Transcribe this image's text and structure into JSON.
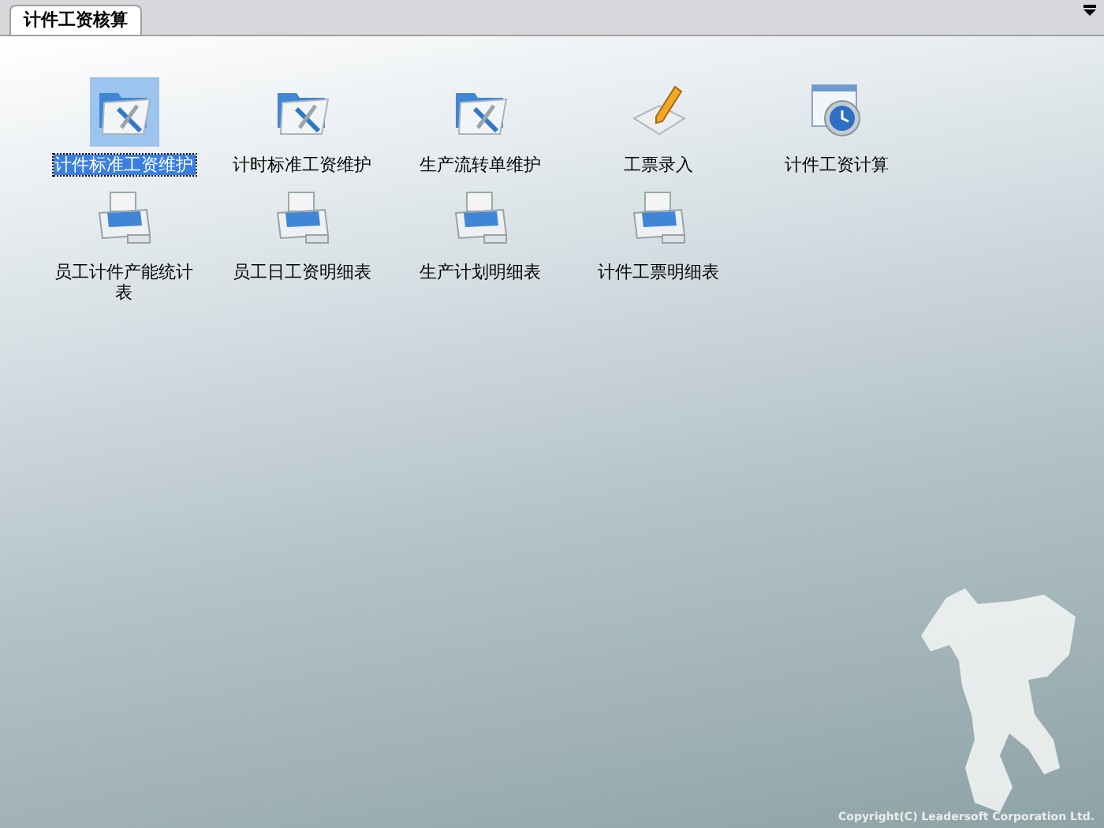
{
  "tabs": [
    {
      "label": "计件工资核算",
      "selected": true
    }
  ],
  "items": [
    {
      "label": "计件标准工资维护",
      "kind": "folder",
      "selected": true
    },
    {
      "label": "计时标准工资维护",
      "kind": "folder",
      "selected": false
    },
    {
      "label": "生产流转单维护",
      "kind": "folder",
      "selected": false
    },
    {
      "label": "工票录入",
      "kind": "pencil",
      "selected": false
    },
    {
      "label": "计件工资计算",
      "kind": "clock",
      "selected": false
    },
    {
      "label": "员工计件产能统计表",
      "kind": "printer",
      "selected": false
    },
    {
      "label": "员工日工资明细表",
      "kind": "printer",
      "selected": false
    },
    {
      "label": "生产计划明细表",
      "kind": "printer",
      "selected": false
    },
    {
      "label": "计件工票明细表",
      "kind": "printer",
      "selected": false
    }
  ],
  "copyright": "Copyright(C) Leadersoft Corporation Ltd."
}
